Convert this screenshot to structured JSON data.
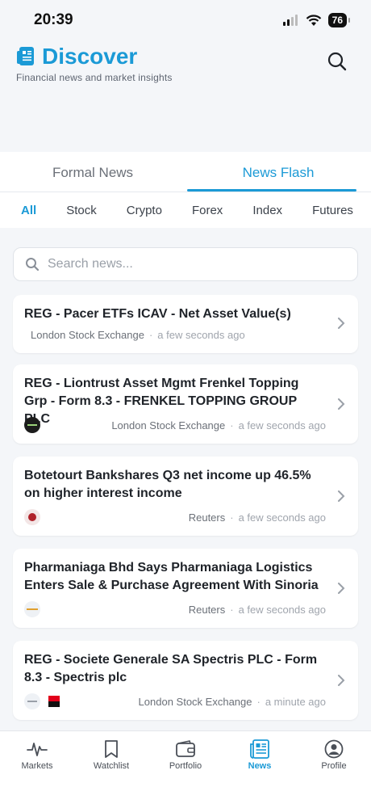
{
  "status": {
    "time": "20:39",
    "battery": "76"
  },
  "header": {
    "title": "Discover",
    "subtitle": "Financial news and market insights"
  },
  "main_tabs": [
    {
      "label": "Formal News"
    },
    {
      "label": "News Flash"
    }
  ],
  "category_tabs": [
    {
      "label": "All"
    },
    {
      "label": "Stock"
    },
    {
      "label": "Crypto"
    },
    {
      "label": "Forex"
    },
    {
      "label": "Index"
    },
    {
      "label": "Futures"
    }
  ],
  "search": {
    "placeholder": "Search news...",
    "value": ""
  },
  "news": [
    {
      "title": "REG - Pacer ETFs ICAV - Net Asset Value(s)",
      "source": "London Stock Exchange",
      "time": "a few seconds ago"
    },
    {
      "title": "REG - Liontrust Asset Mgmt Frenkel Topping Grp - Form 8.3 - FRENKEL TOPPING GROUP PLC",
      "source": "London Stock Exchange",
      "time": "a few seconds ago"
    },
    {
      "title": "Botetourt Bankshares Q3 net income up 46.5% on higher interest income",
      "source": "Reuters",
      "time": "a few seconds ago"
    },
    {
      "title": "Pharmaniaga Bhd Says Pharmaniaga Logistics Enters Sale & Purchase Agreement With Sinoria",
      "source": "Reuters",
      "time": "a few seconds ago"
    },
    {
      "title": "REG - Societe Generale SA Spectris PLC - Form 8.3 - Spectris plc",
      "source": "London Stock Exchange",
      "time": "a minute ago"
    }
  ],
  "bottom_nav": [
    {
      "label": "Markets",
      "icon": "pulse-icon"
    },
    {
      "label": "Watchlist",
      "icon": "bookmark-icon"
    },
    {
      "label": "Portfolio",
      "icon": "wallet-icon"
    },
    {
      "label": "News",
      "icon": "newspaper-icon"
    },
    {
      "label": "Profile",
      "icon": "user-icon"
    }
  ],
  "colors": {
    "accent": "#1b9ad6"
  }
}
